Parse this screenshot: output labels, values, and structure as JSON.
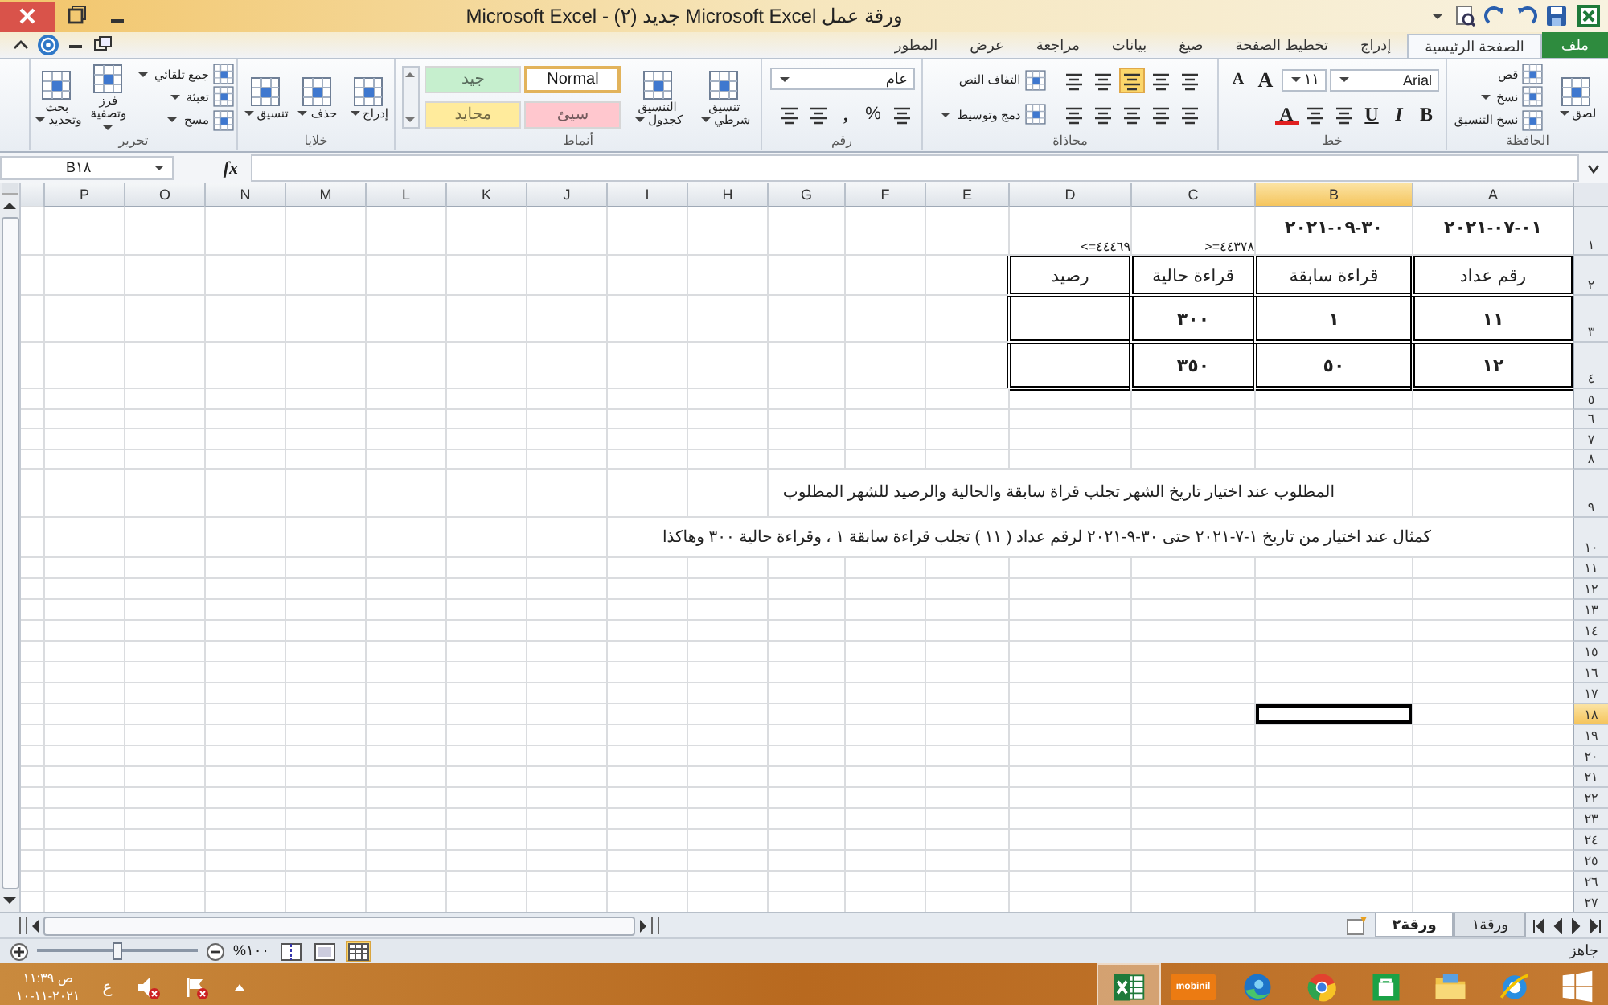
{
  "window": {
    "title": "ورقة عمل Microsoft Excel جديد (٢) - Microsoft Excel"
  },
  "ribbon_tabs": [
    {
      "label": "ملف",
      "kind": "file",
      "selected": false
    },
    {
      "label": "الصفحة الرئيسية",
      "kind": "tab",
      "selected": true
    },
    {
      "label": "إدراج",
      "kind": "tab",
      "selected": false
    },
    {
      "label": "تخطيط الصفحة",
      "kind": "tab",
      "selected": false
    },
    {
      "label": "صيغ",
      "kind": "tab",
      "selected": false
    },
    {
      "label": "بيانات",
      "kind": "tab",
      "selected": false
    },
    {
      "label": "مراجعة",
      "kind": "tab",
      "selected": false
    },
    {
      "label": "عرض",
      "kind": "tab",
      "selected": false
    },
    {
      "label": "المطور",
      "kind": "tab",
      "selected": false
    }
  ],
  "ribbon_groups": [
    {
      "label": "الحافظة",
      "columns": [
        [
          [
            {
              "kind": "large",
              "label": "لصق",
              "dropdown": true
            }
          ]
        ],
        [
          [
            {
              "kind": "small",
              "label": "قص",
              "dropdown": false
            }
          ],
          [
            {
              "kind": "small",
              "label": "نسخ",
              "dropdown": true
            }
          ],
          [
            {
              "kind": "small",
              "label": "نسخ التنسيق",
              "dropdown": false
            }
          ]
        ]
      ]
    },
    {
      "label": "خط",
      "columns": [
        [
          [
            {
              "kind": "fontbox",
              "value": "Arial"
            },
            {
              "kind": "sizebox",
              "value": "١١"
            },
            {
              "kind": "grow",
              "label": "A"
            },
            {
              "kind": "shrink",
              "label": "A"
            }
          ],
          [
            {
              "kind": "bold",
              "label": "B"
            },
            {
              "kind": "italic",
              "label": "I"
            },
            {
              "kind": "underline",
              "label": "U"
            },
            {
              "kind": "icon",
              "selected": false
            },
            {
              "kind": "icon",
              "selected": false
            },
            {
              "kind": "fontcolor",
              "label": "A"
            }
          ]
        ]
      ]
    },
    {
      "label": "محاذاة",
      "columns": [
        [
          [
            {
              "kind": "icon",
              "selected": false
            },
            {
              "kind": "icon",
              "selected": false
            },
            {
              "kind": "icon",
              "selected": true
            },
            {
              "kind": "icon",
              "selected": false
            },
            {
              "kind": "icon",
              "selected": false
            }
          ],
          [
            {
              "kind": "icon",
              "selected": false
            },
            {
              "kind": "icon",
              "selected": false
            },
            {
              "kind": "icon",
              "selected": false
            },
            {
              "kind": "icon",
              "selected": false
            },
            {
              "kind": "icon",
              "selected": false
            }
          ]
        ],
        [
          [
            {
              "kind": "small",
              "label": "التفاف النص",
              "dropdown": false
            }
          ],
          [
            {
              "kind": "small",
              "label": "دمج وتوسيط",
              "dropdown": true
            }
          ]
        ]
      ]
    },
    {
      "label": "رقم",
      "columns": [
        [
          [
            {
              "kind": "numberbox",
              "value": "عام"
            }
          ],
          [
            {
              "kind": "icon",
              "selected": false
            },
            {
              "kind": "plain",
              "label": "%"
            },
            {
              "kind": "bold",
              "label": ","
            },
            {
              "kind": "icon",
              "selected": false
            },
            {
              "kind": "icon",
              "selected": false
            }
          ]
        ]
      ]
    },
    {
      "label": "أنماط",
      "columns": [
        [
          [
            {
              "kind": "large",
              "label": "تنسيق شرطي",
              "dropdown": true
            }
          ]
        ],
        [
          [
            {
              "kind": "large",
              "label": "التنسيق كجدول",
              "dropdown": true
            }
          ]
        ],
        [
          [
            {
              "kind": "style",
              "label": "Normal",
              "color": "#ffffff",
              "selected": true
            },
            {
              "kind": "style",
              "label": "جيد",
              "color": "#c6efce",
              "selected": false
            }
          ],
          [
            {
              "kind": "style",
              "label": "سيئ",
              "color": "#ffc7ce",
              "selected": false
            },
            {
              "kind": "style",
              "label": "محايد",
              "color": "#ffeb9c",
              "selected": false
            }
          ]
        ]
      ]
    },
    {
      "label": "خلايا",
      "columns": [
        [
          [
            {
              "kind": "large",
              "label": "إدراج",
              "dropdown": true
            }
          ]
        ],
        [
          [
            {
              "kind": "large",
              "label": "حذف",
              "dropdown": true
            }
          ]
        ],
        [
          [
            {
              "kind": "large",
              "label": "تنسيق",
              "dropdown": true
            }
          ]
        ]
      ]
    },
    {
      "label": "تحرير",
      "columns": [
        [
          [
            {
              "kind": "small",
              "label": "جمع تلقائي",
              "dropdown": true
            }
          ],
          [
            {
              "kind": "small",
              "label": "تعبئة",
              "dropdown": true
            }
          ],
          [
            {
              "kind": "small",
              "label": "مسح",
              "dropdown": true
            }
          ]
        ],
        [
          [
            {
              "kind": "large",
              "label": "فرز وتصفية",
              "dropdown": true
            }
          ]
        ],
        [
          [
            {
              "kind": "large",
              "label": "بحث وتحديد",
              "dropdown": true
            }
          ]
        ]
      ]
    }
  ],
  "formula_bar": {
    "name_box": "B١٨",
    "function_label": "fx"
  },
  "sheet": {
    "columns": [
      {
        "label": "A",
        "selected": false
      },
      {
        "label": "B",
        "selected": true
      },
      {
        "label": "C",
        "selected": false
      },
      {
        "label": "D",
        "selected": false
      },
      {
        "label": "E",
        "selected": false
      },
      {
        "label": "F",
        "selected": false
      },
      {
        "label": "G",
        "selected": false
      },
      {
        "label": "H",
        "selected": false
      },
      {
        "label": "I",
        "selected": false
      },
      {
        "label": "J",
        "selected": false
      },
      {
        "label": "K",
        "selected": false
      },
      {
        "label": "L",
        "selected": false
      },
      {
        "label": "M",
        "selected": false
      },
      {
        "label": "N",
        "selected": false
      },
      {
        "label": "O",
        "selected": false
      },
      {
        "label": "P",
        "selected": false
      }
    ],
    "rows": [
      {
        "label": "١",
        "selected": false,
        "bordered": false,
        "cells": [
          {
            "text": "٢٠٢١-٠٧-٠١",
            "kind": "date"
          },
          {
            "text": "٢٠٢١-٠٩-٣٠",
            "kind": "date"
          },
          {
            "text": ">=٤٤٣٧٨",
            "kind": "criteria"
          },
          {
            "text": "<=٤٤٤٦٩",
            "kind": "criteria"
          }
        ]
      },
      {
        "label": "٢",
        "selected": false,
        "bordered": true,
        "cells": [
          {
            "text": "رقم عداد",
            "kind": "header"
          },
          {
            "text": "قراءة سابقة",
            "kind": "header"
          },
          {
            "text": "قراءة حالية",
            "kind": "header"
          },
          {
            "text": "رصيد",
            "kind": "header"
          }
        ]
      },
      {
        "label": "٣",
        "selected": false,
        "bordered": true,
        "cells": [
          {
            "text": "١١",
            "kind": "value"
          },
          {
            "text": "١",
            "kind": "value"
          },
          {
            "text": "٣٠٠",
            "kind": "value"
          }
        ]
      },
      {
        "label": "٤",
        "selected": false,
        "bordered": true,
        "cells": [
          {
            "text": "١٢",
            "kind": "value"
          },
          {
            "text": "٥٠",
            "kind": "value"
          },
          {
            "text": "٣٥٠",
            "kind": "value"
          }
        ]
      },
      {
        "label": "٥",
        "selected": false,
        "bordered": false
      },
      {
        "label": "٦",
        "selected": false,
        "bordered": false
      },
      {
        "label": "٧",
        "selected": false,
        "bordered": false
      },
      {
        "label": "٨",
        "selected": false,
        "bordered": false
      },
      {
        "label": "٩",
        "selected": false,
        "bordered": false,
        "note": "المطلوب عند اختيار تاريخ الشهر تجلب قراة سابقة والحالية والرصيد للشهر المطلوب"
      },
      {
        "label": "١٠",
        "selected": false,
        "bordered": false,
        "note": "كمثال عند اختيار من تاريخ ١-٧-٢٠٢١ حتى ٣٠-٩-٢٠٢١ لرقم عداد ( ١١ ) تجلب قراءة سابقة ١ ، وقراءة حالية ٣٠٠ وهاكذا"
      },
      {
        "label": "١١",
        "selected": false,
        "bordered": false
      },
      {
        "label": "١٢",
        "selected": false,
        "bordered": false
      },
      {
        "label": "١٣",
        "selected": false,
        "bordered": false
      },
      {
        "label": "١٤",
        "selected": false,
        "bordered": false
      },
      {
        "label": "١٥",
        "selected": false,
        "bordered": false
      },
      {
        "label": "١٦",
        "selected": false,
        "bordered": false
      },
      {
        "label": "١٧",
        "selected": false,
        "bordered": false
      },
      {
        "label": "١٨",
        "selected": true,
        "bordered": false
      },
      {
        "label": "١٩",
        "selected": false,
        "bordered": false
      },
      {
        "label": "٢٠",
        "selected": false,
        "bordered": false
      },
      {
        "label": "٢١",
        "selected": false,
        "bordered": false
      },
      {
        "label": "٢٢",
        "selected": false,
        "bordered": false
      },
      {
        "label": "٢٣",
        "selected": false,
        "bordered": false
      },
      {
        "label": "٢٤",
        "selected": false,
        "bordered": false
      },
      {
        "label": "٢٥",
        "selected": false,
        "bordered": false
      },
      {
        "label": "٢٦",
        "selected": false,
        "bordered": false
      },
      {
        "label": "٢٧",
        "selected": false,
        "bordered": false
      }
    ]
  },
  "sheet_tabs": [
    {
      "label": "ورقة١",
      "selected": false
    },
    {
      "label": "ورقة٢",
      "selected": true
    }
  ],
  "status_bar": {
    "status": "جاهز",
    "zoom": "%١٠٠",
    "zoom_slider": {
      "level": 0.5
    },
    "views": [
      {
        "selected": true
      },
      {
        "selected": false
      },
      {
        "selected": false
      }
    ]
  },
  "taskbar": {
    "apps": [
      {
        "kind": "start",
        "selected": false
      },
      {
        "kind": "ie",
        "selected": false
      },
      {
        "kind": "explorer",
        "selected": false
      },
      {
        "kind": "store",
        "selected": false
      },
      {
        "kind": "chrome",
        "selected": false
      },
      {
        "kind": "edge",
        "selected": false
      },
      {
        "kind": "mobinil",
        "label": "mobinil",
        "selected": false
      },
      {
        "kind": "excel",
        "selected": true
      }
    ],
    "language": "ع",
    "time": "١١:٣٩ ص",
    "date": "١٠-١١-٢٠٢١"
  }
}
